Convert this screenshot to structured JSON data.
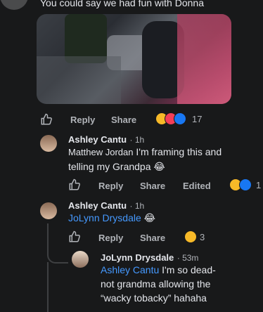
{
  "top_comment": {
    "text": "You could say we had fun with Donna",
    "image_alt": "Party photo",
    "actions": {
      "reply": "Reply",
      "share": "Share",
      "reaction_count": "17"
    }
  },
  "replies": [
    {
      "author": "Ashley Cantu",
      "time": "1h",
      "mention": "Matthew Jordan",
      "text": "I'm framing this and telling my Grandpa 😂",
      "actions": {
        "reply": "Reply",
        "share": "Share",
        "edited": "Edited",
        "reaction_count": "1"
      }
    },
    {
      "author": "Ashley Cantu",
      "time": "1h",
      "mention": "JoLynn Drysdale",
      "text": "😂",
      "actions": {
        "reply": "Reply",
        "share": "Share",
        "reaction_count": "3"
      }
    },
    {
      "author": "JoLynn Drysdale",
      "time": "53m",
      "mention": "Ashley Cantu",
      "text_line1": "I'm so dead-",
      "text_line2": "not grandma allowing the",
      "text_line3": "“wacky tobacky” hahaha"
    }
  ],
  "colors": {
    "background": "#18191a",
    "link": "#4599ff",
    "muted": "#b0b3b8",
    "like_blue": "#1877f2",
    "love_red": "#f33e58",
    "haha_yellow": "#f7b928"
  }
}
